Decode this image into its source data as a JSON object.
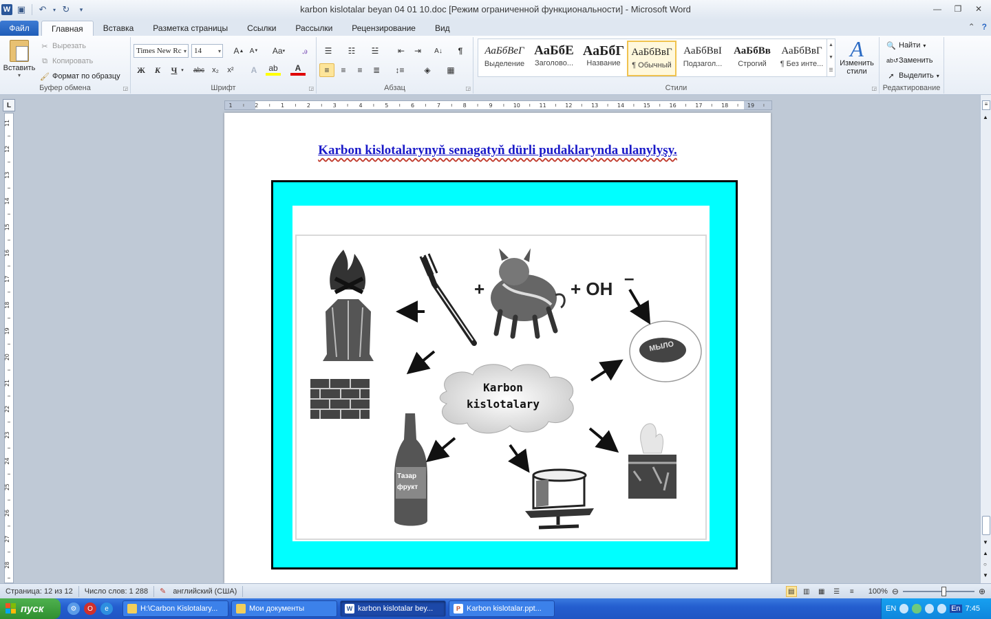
{
  "window": {
    "title": "karbon kislotalar beyan 04 01 10.doc [Режим ограниченной функциональности]  -  Microsoft Word",
    "app_letter": "W"
  },
  "tabs": {
    "file": "Файл",
    "items": [
      "Главная",
      "Вставка",
      "Разметка страницы",
      "Ссылки",
      "Рассылки",
      "Рецензирование",
      "Вид"
    ],
    "active_index": 0
  },
  "clipboard": {
    "paste": "Вставить",
    "cut": "Вырезать",
    "copy": "Копировать",
    "format_painter": "Формат по образцу",
    "label": "Буфер обмена"
  },
  "font": {
    "family": "Times New Rc",
    "size": "14",
    "label": "Шрифт",
    "bold": "Ж",
    "italic": "К",
    "underline": "Ч",
    "strike": "abc",
    "subscript": "x₂",
    "superscript": "x²",
    "change_case": "Aa"
  },
  "paragraph": {
    "label": "Абзац"
  },
  "styles": {
    "label": "Стили",
    "items": [
      {
        "sample": "АаБбВеГ",
        "name": "Выделение"
      },
      {
        "sample": "АаБбЕ",
        "name": "Заголово..."
      },
      {
        "sample": "АаБбГ",
        "name": "Название"
      },
      {
        "sample": "АаБбВвГ",
        "name": "¶ Обычный"
      },
      {
        "sample": "АаБбВвI",
        "name": "Подзагол..."
      },
      {
        "sample": "АаБбВв",
        "name": "Строгий"
      },
      {
        "sample": "АаБбВвГ",
        "name": "¶ Без инте..."
      }
    ],
    "selected_index": 3,
    "change_styles": "Изменить стили"
  },
  "editing": {
    "label": "Редактирование",
    "find": "Найти",
    "replace": "Заменить",
    "select": "Выделить"
  },
  "ruler": {
    "h_numbers": [
      "1",
      "2",
      "1",
      "2",
      "3",
      "4",
      "5",
      "6",
      "7",
      "8",
      "9",
      "10",
      "11",
      "12",
      "13",
      "14",
      "15",
      "16",
      "17",
      "18",
      "19"
    ],
    "v_numbers": [
      "11",
      "12",
      "13",
      "14",
      "15",
      "16",
      "17",
      "18",
      "19",
      "20",
      "21",
      "22",
      "23",
      "24",
      "25",
      "26",
      "27",
      "28"
    ]
  },
  "document": {
    "title": "Karbon kislotalarynyň  senagatyň  dürli  pudaklarynda  ulanylyşy.",
    "diagram": {
      "center": [
        "Karbon",
        "kislotalary"
      ],
      "reaction": [
        "+",
        "+ OH",
        "–"
      ],
      "bottle_label": [
        "Тазар",
        "фрукт"
      ],
      "soap_label": "МЫЛО"
    }
  },
  "status": {
    "page": "Страница: 12 из 12",
    "words": "Число слов: 1 288",
    "language": "английский (США)",
    "zoom": "100%"
  },
  "taskbar": {
    "start": "пуск",
    "tasks": [
      {
        "label": "H:\\Carbon Kislotalary...",
        "icon": "folder"
      },
      {
        "label": "Мои документы",
        "icon": "folder"
      },
      {
        "label": "karbon kislotalar bey...",
        "icon": "word",
        "active": true
      },
      {
        "label": "Karbon kislotalar.ppt...",
        "icon": "powerpoint"
      }
    ],
    "lang": "EN",
    "lang2": "En",
    "clock": "7:45"
  },
  "colors": {
    "frame_fill": "#00ffff",
    "title_text": "#1a1ac8",
    "ribbon_accent": "#2b579a"
  }
}
